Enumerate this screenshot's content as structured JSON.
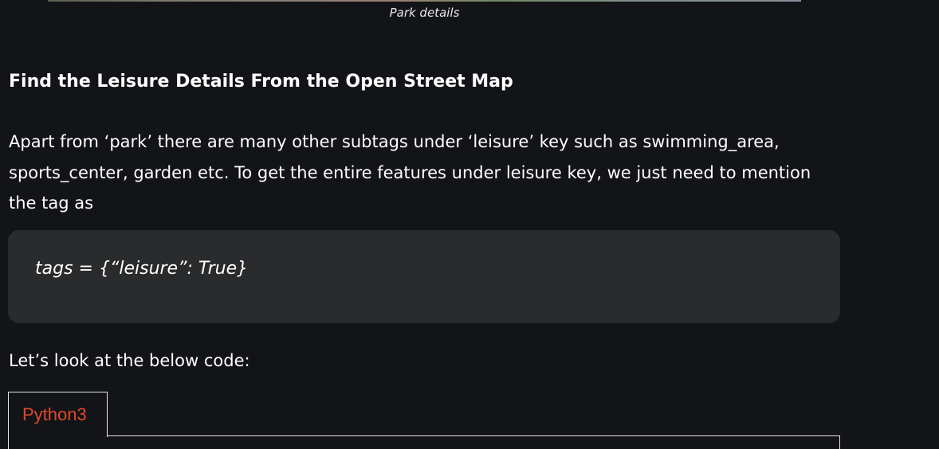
{
  "figure": {
    "caption": "Park details"
  },
  "article": {
    "heading": "Find the Leisure Details From the Open Street Map",
    "paragraph": "Apart from ‘park’ there are many other subtags under ‘leisure’ key such as swimming_area, sports_center, garden etc. To get the entire features under leisure key, we just need to mention the tag as",
    "code_snippet": "tags = {“leisure”: True}",
    "paragraph2": "Let’s look at the below code:"
  },
  "code_tabs": {
    "active_tab": "Python3"
  },
  "colors": {
    "background": "#131417",
    "code_block": "#2a2b2d",
    "tab_accent": "#e0482a"
  }
}
